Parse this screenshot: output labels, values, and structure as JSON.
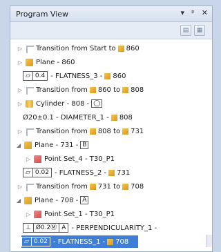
{
  "panel": {
    "title": "Program View",
    "controls": [
      "▾",
      "ᵖ",
      "✕"
    ]
  },
  "tree": [
    {
      "text": "Transition from Start to",
      "tail": "860",
      "icon": "transition-icon"
    },
    {
      "text": "Plane - 860",
      "icon": "plane-icon"
    },
    {
      "fcf": [
        "▱",
        "0.4"
      ],
      "text": "- FLATNESS_3 -",
      "tail": "860"
    },
    {
      "text": "Transition from",
      "mid": "860 to",
      "tail": "808",
      "icon": "transition-icon"
    },
    {
      "text": "Cylinder - 808 -",
      "boxed": "◯",
      "icon": "cylinder-icon"
    },
    {
      "text": "Ø20±0.1 - DIAMETER_1 -",
      "tail": "808"
    },
    {
      "text": "Transition from",
      "mid": "808 to",
      "tail": "731",
      "icon": "transition-icon"
    },
    {
      "text": "Plane - 731 -",
      "boxed": "B",
      "icon": "plane-icon"
    },
    {
      "text": "Point Set_4 - T30_P1",
      "icon": "point-set-icon"
    },
    {
      "fcf": [
        "▱",
        "0.02"
      ],
      "text": "- FLATNESS_2 -",
      "tail": "731"
    },
    {
      "text": "Transition from",
      "mid": "731 to",
      "tail": "708",
      "icon": "transition-icon"
    },
    {
      "text": "Plane - 708 -",
      "boxed": "A",
      "icon": "plane-icon"
    },
    {
      "text": "Point Set_1 - T30_P1",
      "icon": "point-set-icon"
    },
    {
      "fcf": [
        "⊥",
        "Ø0.2Ⓜ",
        "A"
      ],
      "text": "- PERPENDICULARITY_1 -"
    },
    {
      "fcf": [
        "▱",
        "0.02"
      ],
      "text": "- FLATNESS_1 -",
      "tail": "708",
      "selected": true
    }
  ]
}
